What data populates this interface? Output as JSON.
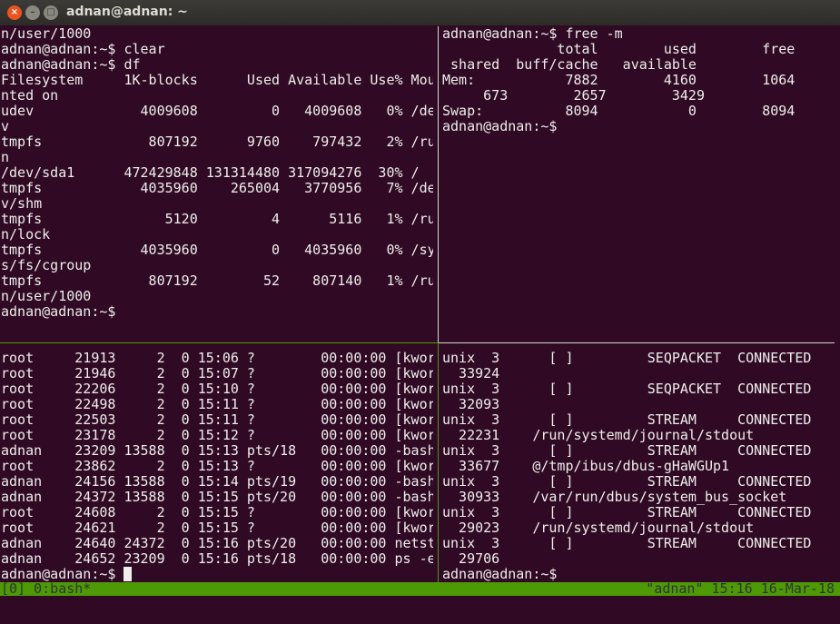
{
  "window": {
    "title": "adnan@adnan: ~",
    "close_glyph": "×",
    "min_glyph": "–",
    "max_glyph": "□"
  },
  "colors": {
    "background": "#300a24",
    "text": "#eeeeec",
    "status_bar": "#4e9a06",
    "active_border": "#4e9a06",
    "inactive_border": "#d3d7cf"
  },
  "panes": {
    "top_left": [
      "n/user/1000",
      "adnan@adnan:~$ clear",
      "adnan@adnan:~$ df",
      "Filesystem     1K-blocks      Used Available Use% Mou",
      "nted on",
      "udev             4009608         0   4009608   0% /de",
      "v",
      "tmpfs             807192      9760    797432   2% /ru",
      "n",
      "/dev/sda1      472429848 131314480 317094276  30% /",
      "tmpfs            4035960    265004   3770956   7% /de",
      "v/shm",
      "tmpfs               5120         4      5116   1% /ru",
      "n/lock",
      "tmpfs            4035960         0   4035960   0% /sy",
      "s/fs/cgroup",
      "tmpfs             807192        52    807140   1% /ru",
      "n/user/1000",
      "adnan@adnan:~$"
    ],
    "top_right": [
      "adnan@adnan:~$ free -m",
      "              total        used        free",
      " shared  buff/cache   available",
      "Mem:           7882        4160        1064",
      "     673        2657        3429",
      "Swap:          8094           0        8094",
      "adnan@adnan:~$"
    ],
    "bottom_left": [
      "root     21913     2  0 15:06 ?        00:00:00 [kwor",
      "root     21946     2  0 15:07 ?        00:00:00 [kwor",
      "root     22206     2  0 15:10 ?        00:00:00 [kwor",
      "root     22498     2  0 15:11 ?        00:00:00 [kwor",
      "root     22503     2  0 15:11 ?        00:00:00 [kwor",
      "root     23178     2  0 15:12 ?        00:00:00 [kwor",
      "adnan    23209 13588  0 15:13 pts/18   00:00:00 -bash",
      "root     23862     2  0 15:13 ?        00:00:00 [kwor",
      "adnan    24156 13588  0 15:14 pts/19   00:00:00 -bash",
      "adnan    24372 13588  0 15:15 pts/20   00:00:00 -bash",
      "root     24608     2  0 15:15 ?        00:00:00 [kwor",
      "root     24621     2  0 15:15 ?        00:00:00 [kwor",
      "adnan    24640 24372  0 15:16 pts/20   00:00:00 netst",
      "adnan    24652 23209  0 15:16 pts/18   00:00:00 ps -e",
      "adnan@adnan:~$ "
    ],
    "bottom_right": [
      "unix  3      [ ]         SEQPACKET  CONNECTED",
      "  33924",
      "unix  3      [ ]         SEQPACKET  CONNECTED",
      "  32093",
      "unix  3      [ ]         STREAM     CONNECTED",
      "  22231    /run/systemd/journal/stdout",
      "unix  3      [ ]         STREAM     CONNECTED",
      "  33677    @/tmp/ibus/dbus-gHaWGUp1",
      "unix  3      [ ]         STREAM     CONNECTED",
      "  30933    /var/run/dbus/system_bus_socket",
      "unix  3      [ ]         STREAM     CONNECTED",
      "  29023    /run/systemd/journal/stdout",
      "unix  3      [ ]         STREAM     CONNECTED",
      "  29706",
      "adnan@adnan:~$"
    ]
  },
  "status_bar": {
    "left": "[0] 0:bash*",
    "right": "\"adnan\" 15:16 16-Mar-18"
  }
}
